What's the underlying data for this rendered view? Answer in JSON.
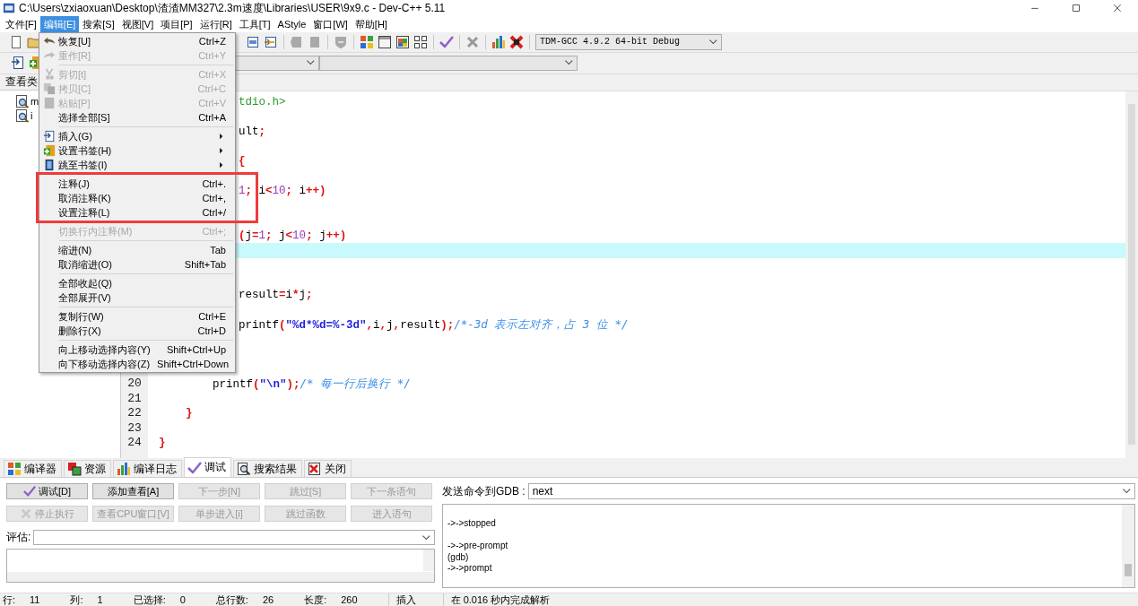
{
  "window": {
    "title": "C:\\Users\\zxiaoxuan\\Desktop\\渣渣MM327\\2.3m速度\\Libraries\\USER\\9x9.c - Dev-C++ 5.11"
  },
  "menu_bar": [
    {
      "label": "文件[F]",
      "selected": false
    },
    {
      "label": "编辑[E]",
      "selected": true
    },
    {
      "label": "搜索[S]",
      "selected": false
    },
    {
      "label": "视图[V]",
      "selected": false
    },
    {
      "label": "项目[P]",
      "selected": false
    },
    {
      "label": "运行[R]",
      "selected": false
    },
    {
      "label": "工具[T]",
      "selected": false
    },
    {
      "label": "AStyle",
      "selected": false
    },
    {
      "label": "窗口[W]",
      "selected": false
    },
    {
      "label": "帮助[H]",
      "selected": false
    }
  ],
  "edit_menu": [
    {
      "kind": "item",
      "label": "恢复[U]",
      "shortcut": "Ctrl+Z",
      "disabled": false
    },
    {
      "kind": "item",
      "label": "重作[R]",
      "shortcut": "Ctrl+Y",
      "disabled": true
    },
    {
      "kind": "separator"
    },
    {
      "kind": "item",
      "label": "剪切[t]",
      "shortcut": "Ctrl+X",
      "disabled": true
    },
    {
      "kind": "item",
      "label": "拷贝[C]",
      "shortcut": "Ctrl+C",
      "disabled": true
    },
    {
      "kind": "item",
      "label": "粘贴[P]",
      "shortcut": "Ctrl+V",
      "disabled": true
    },
    {
      "kind": "item",
      "label": "选择全部[S]",
      "shortcut": "Ctrl+A",
      "disabled": false
    },
    {
      "kind": "separator"
    },
    {
      "kind": "submenu",
      "label": "插入(G)",
      "disabled": false
    },
    {
      "kind": "submenu",
      "label": "设置书签(H)",
      "disabled": false
    },
    {
      "kind": "submenu",
      "label": "跳至书签(I)",
      "disabled": false
    },
    {
      "kind": "separator"
    },
    {
      "kind": "item",
      "label": "注释(J)",
      "shortcut": "Ctrl+.",
      "disabled": false
    },
    {
      "kind": "item",
      "label": "取消注释(K)",
      "shortcut": "Ctrl+,",
      "disabled": false
    },
    {
      "kind": "item",
      "label": "设置注释(L)",
      "shortcut": "Ctrl+/",
      "disabled": false
    },
    {
      "kind": "item",
      "label": "切换行内注释(M)",
      "shortcut": "Ctrl+;",
      "disabled": true
    },
    {
      "kind": "separator"
    },
    {
      "kind": "item",
      "label": "缩进(N)",
      "shortcut": "Tab",
      "disabled": false
    },
    {
      "kind": "item",
      "label": "取消缩进(O)",
      "shortcut": "Shift+Tab",
      "disabled": false
    },
    {
      "kind": "separator"
    },
    {
      "kind": "item",
      "label": "全部收起(Q)",
      "disabled": false
    },
    {
      "kind": "item",
      "label": "全部展开(V)",
      "disabled": false
    },
    {
      "kind": "separator"
    },
    {
      "kind": "item",
      "label": "复制行(W)",
      "shortcut": "Ctrl+E",
      "disabled": false
    },
    {
      "kind": "item",
      "label": "删除行(X)",
      "shortcut": "Ctrl+D",
      "disabled": false
    },
    {
      "kind": "separator"
    },
    {
      "kind": "item",
      "label": "向上移动选择内容(Y)",
      "shortcut": "Shift+Ctrl+Up",
      "disabled": false
    },
    {
      "kind": "item",
      "label": "向下移动选择内容(Z)",
      "shortcut": "Shift+Ctrl+Down",
      "disabled": false
    }
  ],
  "compiler_select": {
    "value": "TDM-GCC 4.9.2 64-bit Debug"
  },
  "class_browser": {
    "tab": "查看类",
    "items": [
      {
        "label": "m"
      },
      {
        "label": "i"
      }
    ]
  },
  "editor": {
    "lines": [
      {
        "current": false,
        "tokens": [
          {
            "kind": "pre",
            "text": "tdio.h>"
          }
        ]
      },
      {
        "current": false
      },
      {
        "current": false,
        "tokens": [
          {
            "kind": "id",
            "text": "ult"
          },
          {
            "kind": "sym",
            "text": ";"
          }
        ]
      },
      {
        "current": false
      },
      {
        "current": false,
        "tokens": [
          {
            "kind": "sym",
            "text": "{"
          }
        ]
      },
      {
        "current": false
      },
      {
        "current": false,
        "tokens": [
          {
            "kind": "num",
            "text": "1"
          },
          {
            "kind": "sym",
            "text": ";"
          },
          {
            "kind": "id",
            "text": " i"
          },
          {
            "kind": "sym",
            "text": "<"
          },
          {
            "kind": "num",
            "text": "10"
          },
          {
            "kind": "sym",
            "text": ";"
          },
          {
            "kind": "id",
            "text": " i"
          },
          {
            "kind": "sym",
            "text": "++)"
          }
        ]
      },
      {
        "current": false
      },
      {
        "current": false
      },
      {
        "current": false,
        "tokens": [
          {
            "kind": "sym",
            "text": "("
          },
          {
            "kind": "id",
            "text": "j"
          },
          {
            "kind": "sym",
            "text": "="
          },
          {
            "kind": "num",
            "text": "1"
          },
          {
            "kind": "sym",
            "text": ";"
          },
          {
            "kind": "id",
            "text": " j"
          },
          {
            "kind": "sym",
            "text": "<"
          },
          {
            "kind": "num",
            "text": "10"
          },
          {
            "kind": "sym",
            "text": ";"
          },
          {
            "kind": "id",
            "text": " j"
          },
          {
            "kind": "sym",
            "text": "++)"
          }
        ]
      },
      {
        "current": true
      },
      {
        "current": false
      },
      {
        "current": false
      },
      {
        "current": false,
        "tokens": [
          {
            "kind": "id",
            "text": "result"
          },
          {
            "kind": "sym",
            "text": "="
          },
          {
            "kind": "id",
            "text": "i"
          },
          {
            "kind": "sym",
            "text": "*"
          },
          {
            "kind": "id",
            "text": "j"
          },
          {
            "kind": "sym",
            "text": ";"
          }
        ]
      },
      {
        "current": false
      },
      {
        "current": false,
        "tokens": [
          {
            "kind": "id",
            "text": "printf"
          },
          {
            "kind": "sym",
            "text": "("
          },
          {
            "kind": "str",
            "text": "\"%d*%d=%-3d\""
          },
          {
            "kind": "sym",
            "text": ","
          },
          {
            "kind": "id",
            "text": "i"
          },
          {
            "kind": "sym",
            "text": ","
          },
          {
            "kind": "id",
            "text": "j"
          },
          {
            "kind": "sym",
            "text": ","
          },
          {
            "kind": "id",
            "text": "result"
          },
          {
            "kind": "sym",
            "text": ");"
          },
          {
            "kind": "com",
            "text": "/*-3d 表示左对齐，占 3 位 */"
          }
        ]
      },
      {
        "current": false
      },
      {
        "current": false
      },
      {
        "current": false
      },
      {
        "current": false,
        "number": "20",
        "tokens": [
          {
            "kind": "id",
            "text": "        printf"
          },
          {
            "kind": "sym",
            "text": "("
          },
          {
            "kind": "str",
            "text": "\"\\n\""
          },
          {
            "kind": "sym",
            "text": ");"
          },
          {
            "kind": "com",
            "text": "/* 每一行后换行 */"
          }
        ]
      },
      {
        "current": false,
        "number": "21"
      },
      {
        "current": false,
        "number": "22",
        "tokens": [
          {
            "kind": "sym",
            "text": "    }"
          }
        ]
      },
      {
        "current": false,
        "number": "23"
      },
      {
        "current": false,
        "number": "24",
        "tokens": [
          {
            "kind": "sym",
            "text": "}"
          }
        ]
      }
    ]
  },
  "bottom_tabs": [
    {
      "label": "编译器",
      "selected": false
    },
    {
      "label": "资源",
      "selected": false
    },
    {
      "label": "编译日志",
      "selected": false
    },
    {
      "label": "调试",
      "selected": true
    },
    {
      "label": "搜索结果",
      "selected": false
    },
    {
      "label": "关闭",
      "selected": false
    }
  ],
  "debug": {
    "buttons": [
      {
        "label": "调试[D]",
        "disabled": false
      },
      {
        "label": "添加查看[A]",
        "disabled": false
      },
      {
        "label": "下一步[N]",
        "disabled": true
      },
      {
        "label": "跳过[S]",
        "disabled": true
      },
      {
        "label": "下一条语句",
        "disabled": true
      },
      {
        "label": "停止执行",
        "disabled": true
      },
      {
        "label": "查看CPU窗口[V]",
        "disabled": true
      },
      {
        "label": "单步进入[i]",
        "disabled": true
      },
      {
        "label": "跳过函数",
        "disabled": true
      },
      {
        "label": "进入语句",
        "disabled": true
      }
    ],
    "evaluate_label": "评估:",
    "gdb_label": "发送命令到GDB :",
    "gdb_command": "next",
    "gdb_output": "->->stopped\n\n->->pre-prompt\n(gdb)\n->->prompt"
  },
  "status_bar": [
    {
      "label": "行:",
      "value": "11"
    },
    {
      "label": "列:",
      "value": "1"
    },
    {
      "label": "已选择:",
      "value": "0"
    },
    {
      "label": "总行数:",
      "value": "26"
    },
    {
      "label": "长度:",
      "value": "260"
    },
    {
      "label": "插入"
    },
    {
      "label": "在 0.016 秒内完成解析"
    }
  ]
}
